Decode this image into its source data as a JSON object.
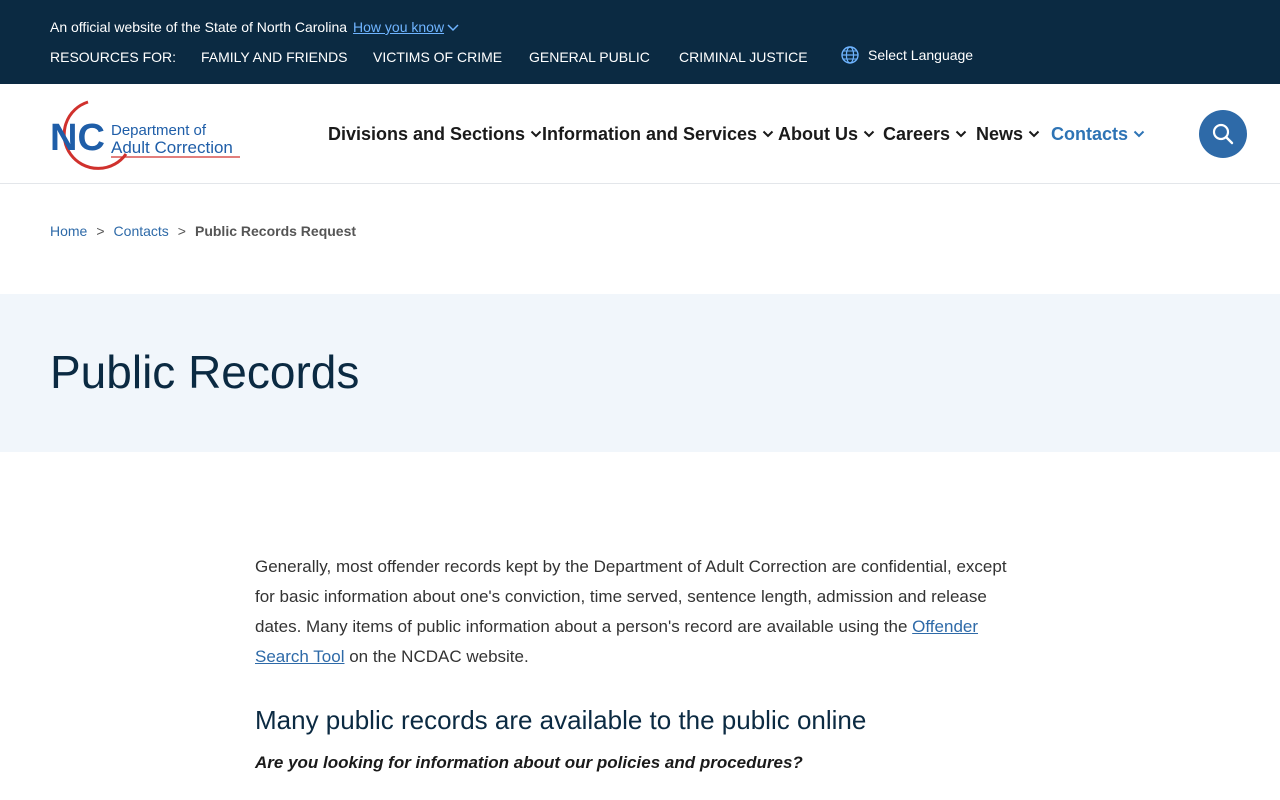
{
  "utility": {
    "official_text": "An official website of the State of North Carolina",
    "how_you_know": "How you know",
    "resources_label": "RESOURCES FOR:",
    "resources": [
      "FAMILY AND FRIENDS",
      "VICTIMS OF CRIME",
      "GENERAL PUBLIC",
      "CRIMINAL JUSTICE"
    ],
    "language_label": "Select Language"
  },
  "logo": {
    "mark": "NC",
    "line1": "Department of",
    "line2": "Adult Correction"
  },
  "nav": {
    "items": [
      "Divisions and Sections",
      "Information and Services",
      "About Us",
      "Careers",
      "News",
      "Contacts"
    ],
    "active": "Contacts"
  },
  "breadcrumb": {
    "home": "Home",
    "parent": "Contacts",
    "current": "Public Records Request",
    "separator": ">"
  },
  "page": {
    "title": "Public Records",
    "intro_before_link": "Generally, most offender records kept by the Department of Adult Correction are confidential, except for basic information about one's conviction, time served, sentence length, admission and release dates. Many items of public information about a person's record are available using the ",
    "intro_link": "Offender Search Tool",
    "intro_after_link": " on the NCDAC website.",
    "section_heading": "Many public records are available to the public online",
    "question": "Are you looking for information about our policies and procedures?"
  },
  "colors": {
    "utility_bg": "#0b2a42",
    "link_blue": "#2e6aa8",
    "active_nav": "#2e74b5",
    "hero_bg": "#f1f6fb",
    "logo_red": "#d0312d"
  },
  "icons": {
    "language": "globe-icon",
    "search": "search-icon",
    "dropdown": "chevron-down-icon"
  }
}
